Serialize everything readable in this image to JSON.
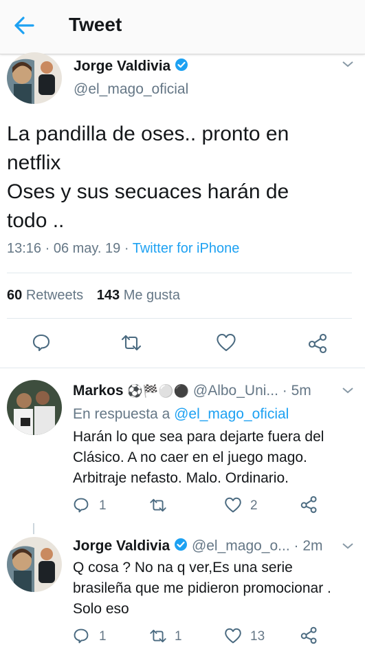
{
  "header": {
    "title": "Tweet"
  },
  "tweet": {
    "author_name": "Jorge Valdivia",
    "handle": "@el_mago_oficial",
    "text_line1": "La pandilla de oses.. pronto en",
    "text_line2": "netflix",
    "text_line3": "Oses y sus secuaces harán de",
    "text_line4": "todo ..",
    "time": "13:16 · 06 may. 19 · ",
    "source": "Twitter for iPhone",
    "retweets_count": "60",
    "retweets_label": "Retweets",
    "likes_count": "143",
    "likes_label": "Me gusta"
  },
  "replies": [
    {
      "name": "Markos",
      "emoji": "⚽🏁⚪⚫",
      "handle": "@Albo_Uni...",
      "time": "· 5m",
      "reply_prefix": "En respuesta a ",
      "reply_to": "@el_mago_oficial",
      "line1": "Harán lo que sea para dejarte fuera del",
      "line2": "Clásico. A no caer en el juego mago.",
      "line3": "Arbitraje nefasto. Malo. Ordinario.",
      "replies_count": "1",
      "retweets_count": "",
      "likes_count": "2"
    },
    {
      "name": "Jorge Valdivia",
      "handle": "@el_mago_o...",
      "time": "· 2m",
      "line1": "Q cosa ? No na q ver,Es una serie",
      "line2": "brasileña que me pidieron promocionar .",
      "line3": "Solo eso",
      "replies_count": "1",
      "retweets_count": "1",
      "likes_count": "13"
    }
  ],
  "colors": {
    "accent": "#1da1f2",
    "muted": "#657786",
    "icon": "#4a6a80"
  },
  "icons": [
    "back-arrow-icon",
    "verified-icon",
    "chevron-down-icon",
    "reply-icon",
    "retweet-icon",
    "like-icon",
    "share-icon"
  ]
}
